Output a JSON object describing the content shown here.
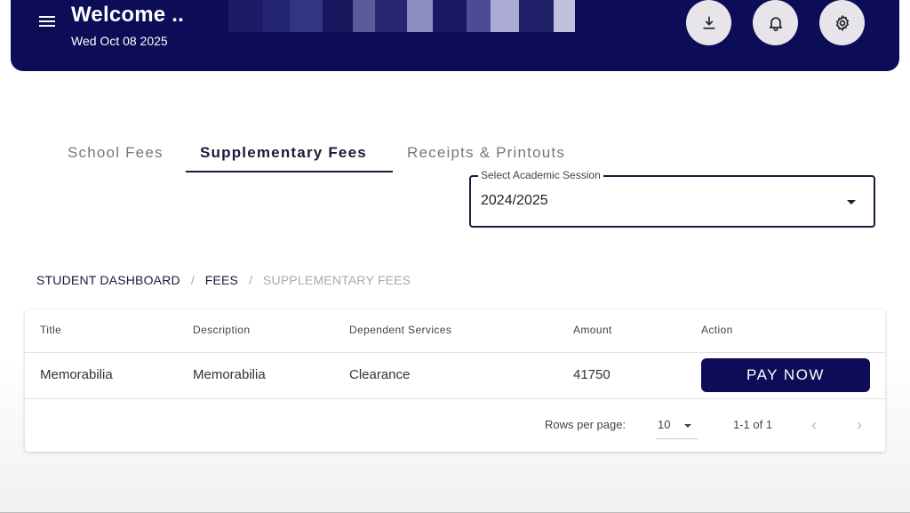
{
  "header": {
    "welcome": "Welcome ..",
    "date": "Wed Oct 08 2025",
    "redaction_colors": [
      "#1e1e6a",
      "#2a2a7a",
      "#3c3c8c",
      "#1a1a5e",
      "#6a6aa8",
      "#2d2d78",
      "#a3a3d4",
      "#1c1c64",
      "#5858a0",
      "#c8c8ea",
      "#24246c",
      "#e0e0f4"
    ]
  },
  "tabs": [
    {
      "label": "School Fees"
    },
    {
      "label": "Supplementary Fees"
    },
    {
      "label": "Receipts & Printouts"
    }
  ],
  "session": {
    "label": "Select Academic Session",
    "value": "2024/2025"
  },
  "breadcrumb": {
    "item1": "STUDENT DASHBOARD",
    "item2": "FEES",
    "current": "SUPPLEMENTARY FEES",
    "separator": "/"
  },
  "table": {
    "columns": [
      "Title",
      "Description",
      "Dependent Services",
      "Amount",
      "Action"
    ],
    "rows": [
      {
        "title": "Memorabilia",
        "description": "Memorabilia",
        "services": "Clearance",
        "amount": "41750",
        "action": "PAY NOW"
      }
    ],
    "rows_per_page_label": "Rows per page:",
    "rows_per_page": "10",
    "range": "1-1 of 1"
  },
  "colors": {
    "primary": "#0c0c57",
    "header_button_bg": "#e7e5ea"
  },
  "icons": {
    "menu": "menu-icon",
    "download": "download-icon",
    "bell": "bell-icon",
    "settings": "gear-icon",
    "dropdown": "caret-down-icon",
    "prev": "chevron-left-icon",
    "next": "chevron-right-icon"
  }
}
